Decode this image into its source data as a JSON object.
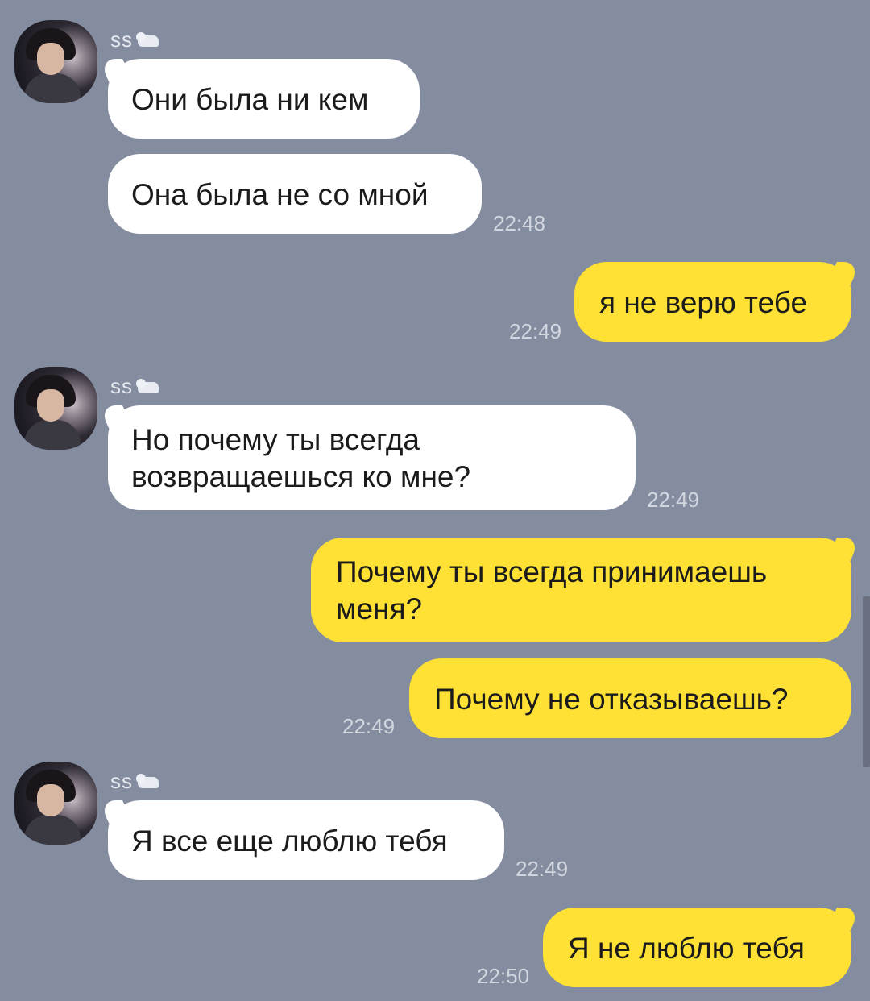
{
  "chat": {
    "sender_name": "ss",
    "sender_emoji_icon": "seal-icon",
    "colors": {
      "background": "#848CA0",
      "incoming_bubble": "#FFFFFF",
      "outgoing_bubble": "#FEE134",
      "timestamp": "#D2D6DF"
    },
    "messages": [
      {
        "direction": "incoming",
        "text": "Они была ни кем",
        "time": ""
      },
      {
        "direction": "incoming",
        "text": "Она была не со мной",
        "time": "22:48"
      },
      {
        "direction": "outgoing",
        "text": "я не верю тебе",
        "time": "22:49"
      },
      {
        "direction": "incoming",
        "text_lines": [
          "Но почему ты всегда",
          "возвращаешься ко мне?"
        ],
        "time": "22:49"
      },
      {
        "direction": "outgoing",
        "text_lines": [
          "Почему ты всегда принимаешь",
          "меня?"
        ],
        "time": ""
      },
      {
        "direction": "outgoing",
        "text": "Почему не отказываешь?",
        "time": "22:49"
      },
      {
        "direction": "incoming",
        "text": "Я все еще люблю тебя",
        "time": "22:49"
      },
      {
        "direction": "outgoing",
        "text": "Я не люблю тебя",
        "time": "22:50"
      }
    ]
  }
}
